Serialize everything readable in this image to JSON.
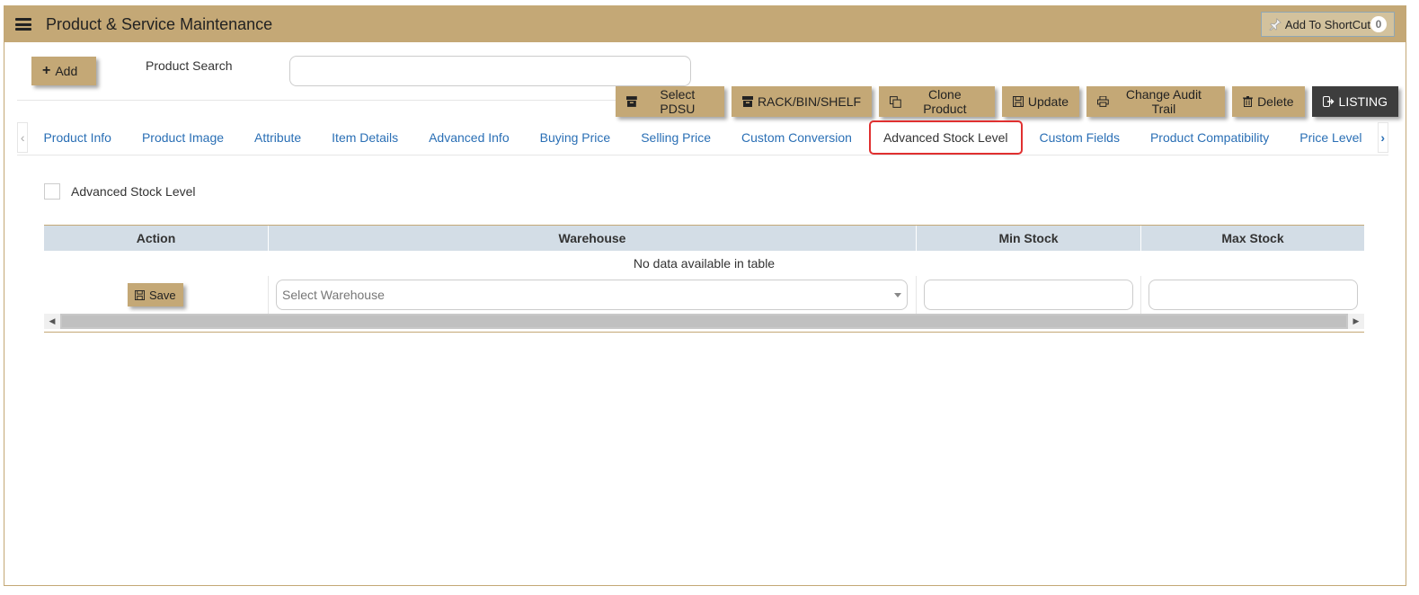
{
  "header": {
    "title": "Product & Service Maintenance",
    "shortcut_label": "Add To ShortCut",
    "shortcut_count": "0"
  },
  "top": {
    "add_label": "Add",
    "search_label": "Product Search",
    "search_value": ""
  },
  "toolbar": {
    "select_pdsu": "Select PDSU",
    "rack_bin_shelf": "RACK/BIN/SHELF",
    "clone_product": "Clone Product",
    "update": "Update",
    "change_audit_trail": "Change Audit Trail",
    "delete": "Delete",
    "listing": "LISTING"
  },
  "tabs": [
    {
      "label": "Product Info",
      "active": false
    },
    {
      "label": "Product Image",
      "active": false
    },
    {
      "label": "Attribute",
      "active": false
    },
    {
      "label": "Item Details",
      "active": false
    },
    {
      "label": "Advanced Info",
      "active": false
    },
    {
      "label": "Buying Price",
      "active": false
    },
    {
      "label": "Selling Price",
      "active": false
    },
    {
      "label": "Custom Conversion",
      "active": false
    },
    {
      "label": "Advanced Stock Level",
      "active": true
    },
    {
      "label": "Custom Fields",
      "active": false
    },
    {
      "label": "Product Compatibility",
      "active": false
    },
    {
      "label": "Price Level",
      "active": false
    }
  ],
  "panel": {
    "checkbox_label": "Advanced Stock Level",
    "columns": [
      "Action",
      "Warehouse",
      "Min Stock",
      "Max Stock"
    ],
    "empty_message": "No data available in table",
    "save_label": "Save",
    "warehouse_placeholder": "Select Warehouse",
    "min_stock_value": "",
    "max_stock_value": ""
  },
  "colors": {
    "accent": "#c4a876",
    "header_row": "#d3dde6",
    "tab_link": "#2a6fb5",
    "active_tab_border": "#e03030",
    "dark_button": "#3d3d3d"
  }
}
